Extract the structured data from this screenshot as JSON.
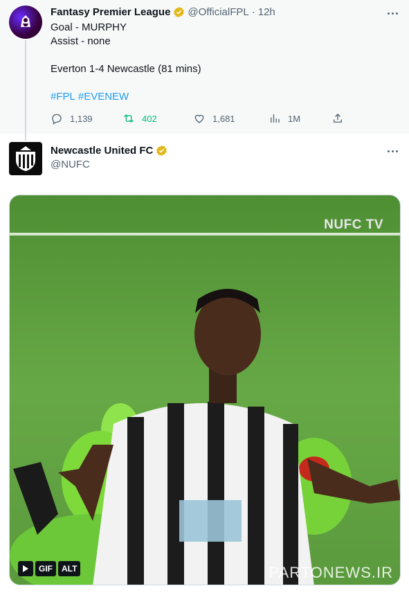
{
  "thread": {
    "parent": {
      "author_name": "Fantasy Premier League",
      "author_handle": "@OfficialFPL",
      "separator": "·",
      "time": "12h",
      "lines": [
        "Goal - MURPHY",
        "Assist - none",
        "Everton 1-4 Newcastle (81 mins)"
      ],
      "hashtags": [
        "#FPL",
        "#EVENEW"
      ],
      "stats": {
        "replies": "1,139",
        "retweets": "402",
        "likes": "1,681",
        "views": "1M"
      }
    },
    "reply": {
      "author_name": "Newcastle United FC",
      "author_handle": "@NUFC",
      "media": {
        "watermark": "NUFC TV",
        "badges": [
          "GIF",
          "ALT"
        ],
        "overlay_text": "PARTONEWS.IR"
      }
    }
  },
  "colors": {
    "link": "#1d9bf0",
    "verified": "#e2b719",
    "retweet_green": "#00ba7c",
    "muted": "#536471",
    "fpl_purple": "#37003c"
  },
  "icons": [
    "reply-icon",
    "retweet-icon",
    "like-icon",
    "views-icon",
    "share-icon",
    "verified-badge-icon",
    "more-icon",
    "play-icon"
  ]
}
